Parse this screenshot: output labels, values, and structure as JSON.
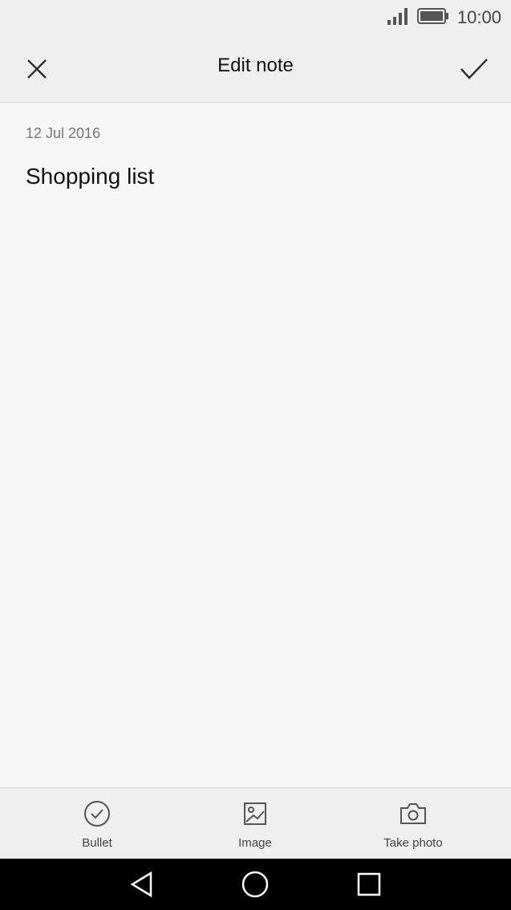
{
  "status_bar": {
    "time": "10:00",
    "signal_icon": "signal-bars-icon",
    "battery_icon": "battery-full-icon"
  },
  "app_bar": {
    "title": "Edit note",
    "close_icon": "close-icon",
    "confirm_icon": "checkmark-icon"
  },
  "note": {
    "date": "12 Jul 2016",
    "text": "Shopping list"
  },
  "toolbar": {
    "items": [
      {
        "label": "Bullet",
        "icon": "checkmark-circle-icon"
      },
      {
        "label": "Image",
        "icon": "image-icon"
      },
      {
        "label": "Take photo",
        "icon": "camera-icon"
      }
    ]
  },
  "nav_bar": {
    "back_icon": "back-triangle-icon",
    "home_icon": "home-circle-icon",
    "recent_icon": "recent-square-icon"
  },
  "colors": {
    "background": "#f7f7f7",
    "bars": "#efefef",
    "nav": "#000000"
  }
}
